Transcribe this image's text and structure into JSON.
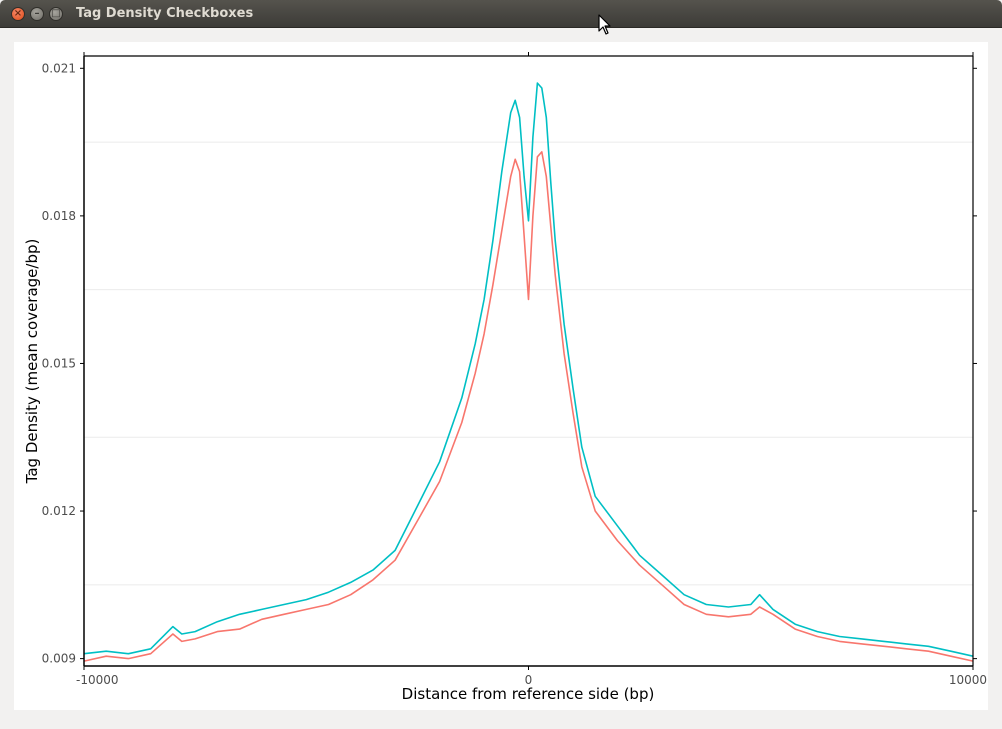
{
  "window": {
    "title": "Tag Density Checkboxes"
  },
  "chart_data": {
    "type": "line",
    "xlabel": "Distance from reference side (bp)",
    "ylabel": "Tag Density (mean coverage/bp)",
    "xlim": [
      -10000,
      10000
    ],
    "ylim": [
      0.00885,
      0.02125
    ],
    "xticks": [
      {
        "value": -10000,
        "label": "-10000"
      },
      {
        "value": 0,
        "label": "0"
      },
      {
        "value": 10000,
        "label": "10000"
      }
    ],
    "yticks": [
      {
        "value": 0.009,
        "label": "0.009"
      },
      {
        "value": 0.012,
        "label": "0.012"
      },
      {
        "value": 0.015,
        "label": "0.015"
      },
      {
        "value": 0.018,
        "label": "0.018"
      },
      {
        "value": 0.021,
        "label": "0.021"
      }
    ],
    "minor_gridlines": [
      0.0105,
      0.0135,
      0.0165,
      0.0195
    ],
    "grid": true,
    "legend": false,
    "series": [
      {
        "color": "#f8766d",
        "x": [
          -10000,
          -9500,
          -9000,
          -8500,
          -8000,
          -7800,
          -7500,
          -7000,
          -6500,
          -6000,
          -5500,
          -5000,
          -4500,
          -4000,
          -3500,
          -3000,
          -2500,
          -2000,
          -1500,
          -1200,
          -1000,
          -800,
          -600,
          -400,
          -300,
          -200,
          -100,
          0,
          100,
          200,
          300,
          400,
          500,
          600,
          800,
          1000,
          1200,
          1500,
          2000,
          2500,
          3000,
          3500,
          4000,
          4500,
          5000,
          5200,
          5500,
          6000,
          6500,
          7000,
          7500,
          8000,
          8500,
          9000,
          9500,
          10000
        ],
        "y": [
          0.00895,
          0.00905,
          0.009,
          0.0091,
          0.0095,
          0.00935,
          0.0094,
          0.00955,
          0.0096,
          0.0098,
          0.0099,
          0.01,
          0.0101,
          0.0103,
          0.0106,
          0.011,
          0.0118,
          0.0126,
          0.0138,
          0.0148,
          0.0156,
          0.0166,
          0.0177,
          0.0188,
          0.01915,
          0.0189,
          0.0176,
          0.0163,
          0.018,
          0.0192,
          0.0193,
          0.0188,
          0.0178,
          0.0168,
          0.0152,
          0.014,
          0.0129,
          0.012,
          0.0114,
          0.0109,
          0.0105,
          0.0101,
          0.0099,
          0.00985,
          0.0099,
          0.01005,
          0.0099,
          0.0096,
          0.00945,
          0.00935,
          0.0093,
          0.00925,
          0.0092,
          0.00915,
          0.00905,
          0.00895
        ]
      },
      {
        "color": "#00bfc4",
        "x": [
          -10000,
          -9500,
          -9000,
          -8500,
          -8000,
          -7800,
          -7500,
          -7000,
          -6500,
          -6000,
          -5500,
          -5000,
          -4500,
          -4000,
          -3500,
          -3000,
          -2500,
          -2000,
          -1500,
          -1200,
          -1000,
          -800,
          -600,
          -400,
          -300,
          -200,
          -100,
          0,
          100,
          200,
          300,
          400,
          500,
          600,
          800,
          1000,
          1200,
          1500,
          2000,
          2500,
          3000,
          3500,
          4000,
          4500,
          5000,
          5200,
          5500,
          6000,
          6500,
          7000,
          7500,
          8000,
          8500,
          9000,
          9500,
          10000
        ],
        "y": [
          0.0091,
          0.00915,
          0.0091,
          0.0092,
          0.00965,
          0.0095,
          0.00955,
          0.00975,
          0.0099,
          0.01,
          0.0101,
          0.0102,
          0.01035,
          0.01055,
          0.0108,
          0.0112,
          0.0121,
          0.013,
          0.0143,
          0.0154,
          0.0163,
          0.0175,
          0.0189,
          0.0201,
          0.02035,
          0.02,
          0.0188,
          0.0179,
          0.0196,
          0.0207,
          0.0206,
          0.02,
          0.0187,
          0.0175,
          0.0158,
          0.0145,
          0.0133,
          0.0123,
          0.0117,
          0.0111,
          0.0107,
          0.0103,
          0.0101,
          0.01005,
          0.0101,
          0.0103,
          0.01,
          0.0097,
          0.00955,
          0.00945,
          0.0094,
          0.00935,
          0.0093,
          0.00925,
          0.00915,
          0.00905
        ]
      }
    ]
  }
}
